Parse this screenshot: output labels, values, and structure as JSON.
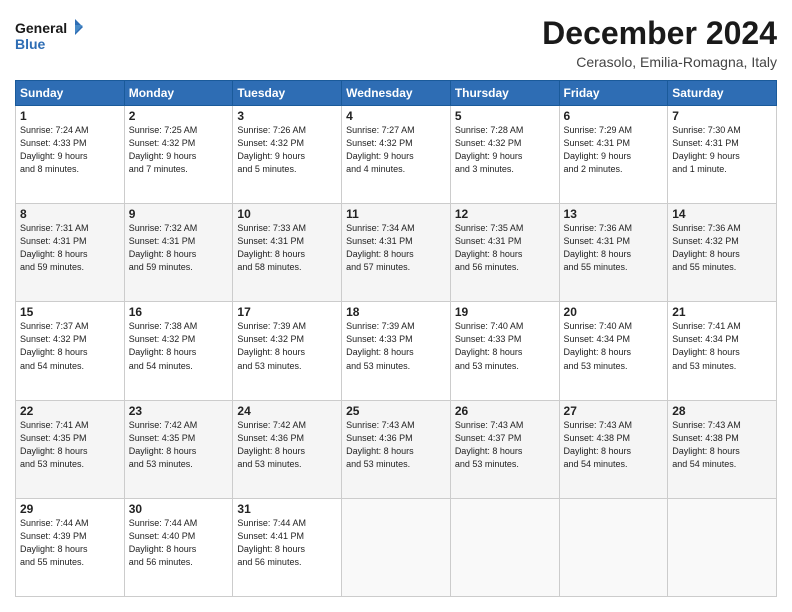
{
  "header": {
    "logo_line1": "General",
    "logo_line2": "Blue",
    "title": "December 2024",
    "subtitle": "Cerasolo, Emilia-Romagna, Italy"
  },
  "weekdays": [
    "Sunday",
    "Monday",
    "Tuesday",
    "Wednesday",
    "Thursday",
    "Friday",
    "Saturday"
  ],
  "weeks": [
    [
      {
        "day": "1",
        "info": "Sunrise: 7:24 AM\nSunset: 4:33 PM\nDaylight: 9 hours\nand 8 minutes."
      },
      {
        "day": "2",
        "info": "Sunrise: 7:25 AM\nSunset: 4:32 PM\nDaylight: 9 hours\nand 7 minutes."
      },
      {
        "day": "3",
        "info": "Sunrise: 7:26 AM\nSunset: 4:32 PM\nDaylight: 9 hours\nand 5 minutes."
      },
      {
        "day": "4",
        "info": "Sunrise: 7:27 AM\nSunset: 4:32 PM\nDaylight: 9 hours\nand 4 minutes."
      },
      {
        "day": "5",
        "info": "Sunrise: 7:28 AM\nSunset: 4:32 PM\nDaylight: 9 hours\nand 3 minutes."
      },
      {
        "day": "6",
        "info": "Sunrise: 7:29 AM\nSunset: 4:31 PM\nDaylight: 9 hours\nand 2 minutes."
      },
      {
        "day": "7",
        "info": "Sunrise: 7:30 AM\nSunset: 4:31 PM\nDaylight: 9 hours\nand 1 minute."
      }
    ],
    [
      {
        "day": "8",
        "info": "Sunrise: 7:31 AM\nSunset: 4:31 PM\nDaylight: 8 hours\nand 59 minutes."
      },
      {
        "day": "9",
        "info": "Sunrise: 7:32 AM\nSunset: 4:31 PM\nDaylight: 8 hours\nand 59 minutes."
      },
      {
        "day": "10",
        "info": "Sunrise: 7:33 AM\nSunset: 4:31 PM\nDaylight: 8 hours\nand 58 minutes."
      },
      {
        "day": "11",
        "info": "Sunrise: 7:34 AM\nSunset: 4:31 PM\nDaylight: 8 hours\nand 57 minutes."
      },
      {
        "day": "12",
        "info": "Sunrise: 7:35 AM\nSunset: 4:31 PM\nDaylight: 8 hours\nand 56 minutes."
      },
      {
        "day": "13",
        "info": "Sunrise: 7:36 AM\nSunset: 4:31 PM\nDaylight: 8 hours\nand 55 minutes."
      },
      {
        "day": "14",
        "info": "Sunrise: 7:36 AM\nSunset: 4:32 PM\nDaylight: 8 hours\nand 55 minutes."
      }
    ],
    [
      {
        "day": "15",
        "info": "Sunrise: 7:37 AM\nSunset: 4:32 PM\nDaylight: 8 hours\nand 54 minutes."
      },
      {
        "day": "16",
        "info": "Sunrise: 7:38 AM\nSunset: 4:32 PM\nDaylight: 8 hours\nand 54 minutes."
      },
      {
        "day": "17",
        "info": "Sunrise: 7:39 AM\nSunset: 4:32 PM\nDaylight: 8 hours\nand 53 minutes."
      },
      {
        "day": "18",
        "info": "Sunrise: 7:39 AM\nSunset: 4:33 PM\nDaylight: 8 hours\nand 53 minutes."
      },
      {
        "day": "19",
        "info": "Sunrise: 7:40 AM\nSunset: 4:33 PM\nDaylight: 8 hours\nand 53 minutes."
      },
      {
        "day": "20",
        "info": "Sunrise: 7:40 AM\nSunset: 4:34 PM\nDaylight: 8 hours\nand 53 minutes."
      },
      {
        "day": "21",
        "info": "Sunrise: 7:41 AM\nSunset: 4:34 PM\nDaylight: 8 hours\nand 53 minutes."
      }
    ],
    [
      {
        "day": "22",
        "info": "Sunrise: 7:41 AM\nSunset: 4:35 PM\nDaylight: 8 hours\nand 53 minutes."
      },
      {
        "day": "23",
        "info": "Sunrise: 7:42 AM\nSunset: 4:35 PM\nDaylight: 8 hours\nand 53 minutes."
      },
      {
        "day": "24",
        "info": "Sunrise: 7:42 AM\nSunset: 4:36 PM\nDaylight: 8 hours\nand 53 minutes."
      },
      {
        "day": "25",
        "info": "Sunrise: 7:43 AM\nSunset: 4:36 PM\nDaylight: 8 hours\nand 53 minutes."
      },
      {
        "day": "26",
        "info": "Sunrise: 7:43 AM\nSunset: 4:37 PM\nDaylight: 8 hours\nand 53 minutes."
      },
      {
        "day": "27",
        "info": "Sunrise: 7:43 AM\nSunset: 4:38 PM\nDaylight: 8 hours\nand 54 minutes."
      },
      {
        "day": "28",
        "info": "Sunrise: 7:43 AM\nSunset: 4:38 PM\nDaylight: 8 hours\nand 54 minutes."
      }
    ],
    [
      {
        "day": "29",
        "info": "Sunrise: 7:44 AM\nSunset: 4:39 PM\nDaylight: 8 hours\nand 55 minutes."
      },
      {
        "day": "30",
        "info": "Sunrise: 7:44 AM\nSunset: 4:40 PM\nDaylight: 8 hours\nand 56 minutes."
      },
      {
        "day": "31",
        "info": "Sunrise: 7:44 AM\nSunset: 4:41 PM\nDaylight: 8 hours\nand 56 minutes."
      },
      null,
      null,
      null,
      null
    ]
  ]
}
